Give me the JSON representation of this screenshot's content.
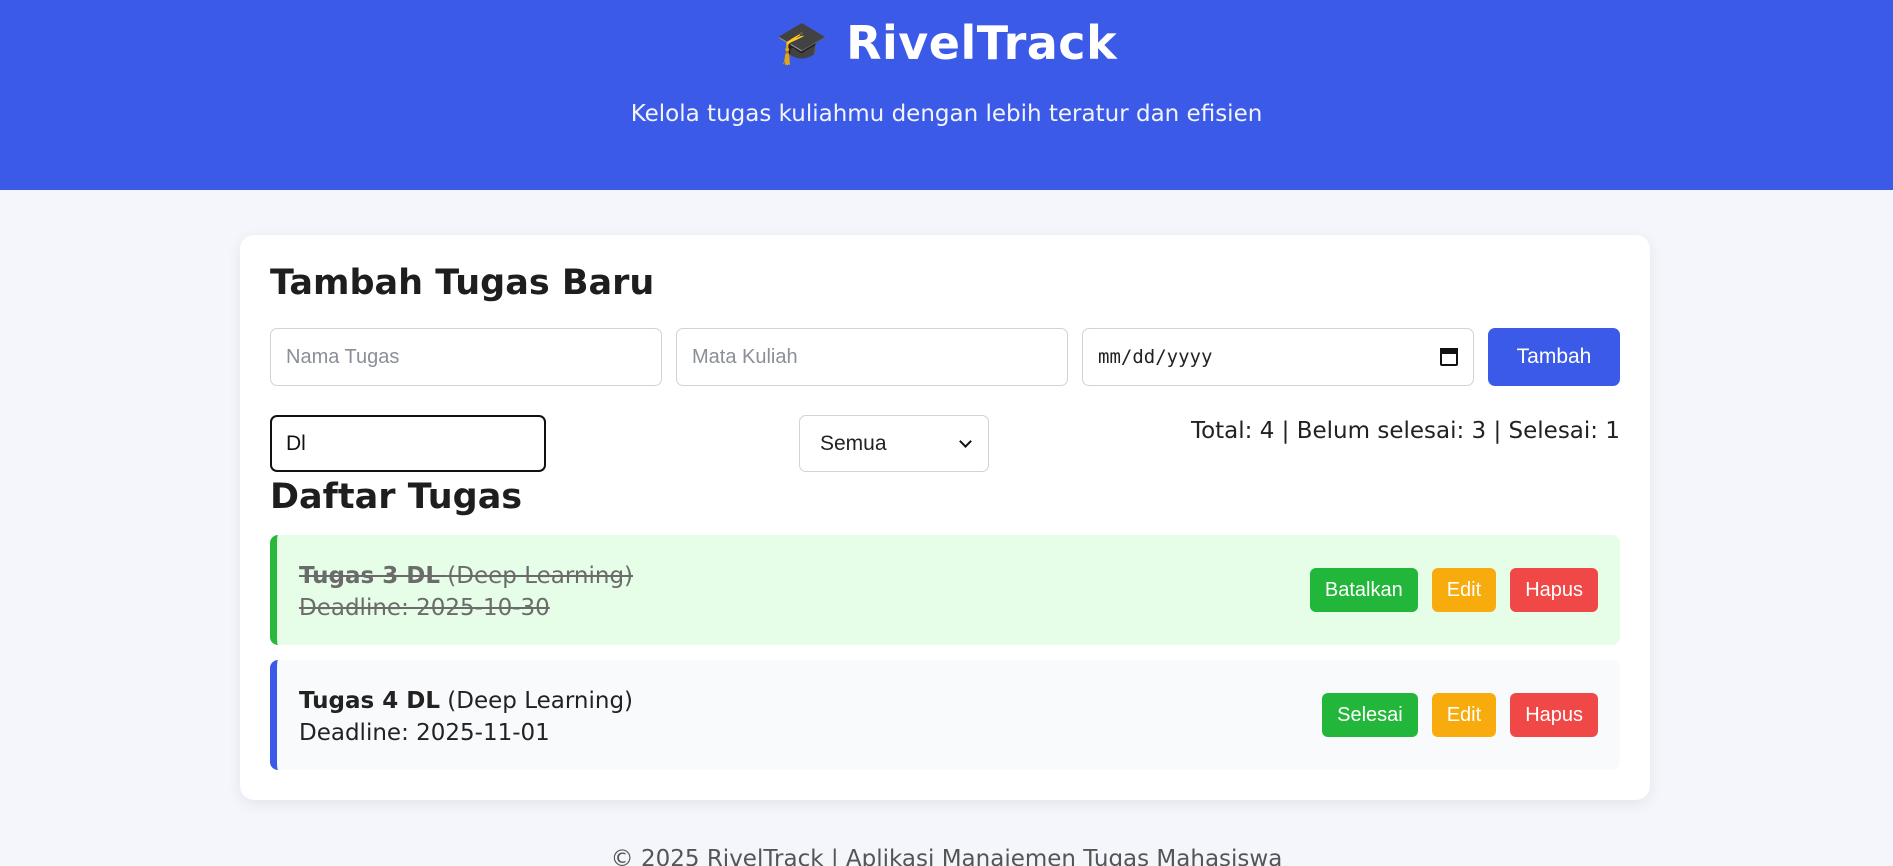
{
  "header": {
    "icon": "graduation-cap-icon",
    "title": "RivelTrack",
    "tagline": "Kelola tugas kuliahmu dengan lebih teratur dan efisien"
  },
  "form": {
    "title": "Tambah Tugas Baru",
    "task_name_placeholder": "Nama Tugas",
    "course_placeholder": "Mata Kuliah",
    "date_placeholder": "mm/dd/yyyy",
    "add_label": "Tambah"
  },
  "toolbar": {
    "search_value": "Dl",
    "filter_selected": "Semua",
    "stats": "Total: 4 | Belum selesai: 3 | Selesai: 1"
  },
  "list": {
    "title": "Daftar Tugas",
    "tasks": [
      {
        "name": "Tugas 3 DL",
        "course": "(Deep Learning)",
        "deadline": "Deadline: 2025-10-30",
        "done": true,
        "toggle_label": "Batalkan",
        "edit_label": "Edit",
        "delete_label": "Hapus"
      },
      {
        "name": "Tugas 4 DL",
        "course": "(Deep Learning)",
        "deadline": "Deadline: 2025-11-01",
        "done": false,
        "toggle_label": "Selesai",
        "edit_label": "Edit",
        "delete_label": "Hapus"
      }
    ]
  },
  "footer": {
    "text": "© 2025 RivelTrack | Aplikasi Manajemen Tugas Mahasiswa"
  },
  "colors": {
    "primary": "#3c5ae8",
    "success": "#22b63a",
    "warning": "#f8ab0c",
    "danger": "#f04747",
    "done_bg": "#e6fde8"
  }
}
